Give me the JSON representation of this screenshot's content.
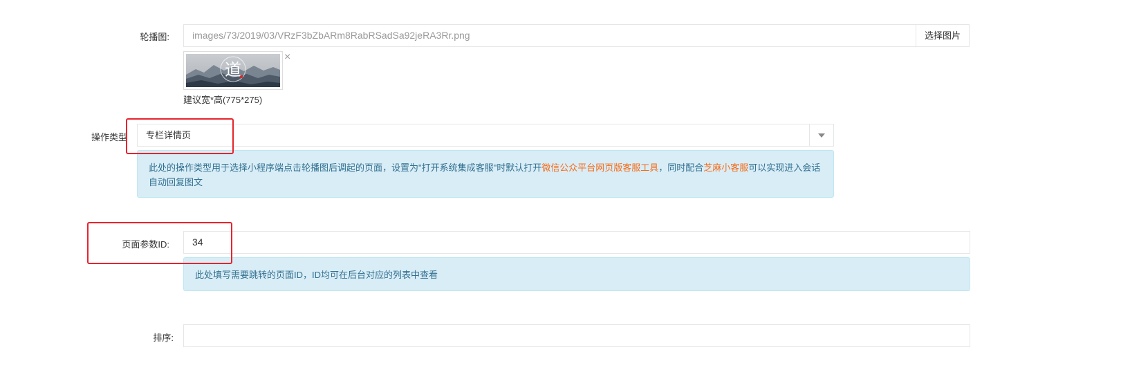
{
  "carousel": {
    "label": "轮播图:",
    "path_value": "images/73/2019/03/VRzF3bZbARm8RabRSadSa92jeRA3Rr.png",
    "choose_button": "选择图片",
    "thumbnail_glyph": "道",
    "remove_symbol": "×",
    "size_hint": "建议宽*高(775*275)"
  },
  "operation_type": {
    "label": "操作类型",
    "selected": "专栏详情页",
    "help_prefix": "此处的操作类型用于选择小程序端点击轮播图后调起的页面，设置为\"打开系统集成客服\"时默认打开",
    "help_link1": "微信公众平台网页版客服工具",
    "help_middle": "，同时配合",
    "help_link2": "芝麻小客服",
    "help_suffix": "可以实现进入会话自动回复图文"
  },
  "page_param": {
    "label": "页面参数ID:",
    "value": "34",
    "help": "此处填写需要跳转的页面ID，ID均可在后台对应的列表中查看"
  },
  "sort": {
    "label": "排序:",
    "value": ""
  },
  "colors": {
    "highlight_box": "#e8232c",
    "alert_bg": "#d9edf7",
    "alert_text": "#31708f",
    "link_orange": "#f56b16"
  }
}
